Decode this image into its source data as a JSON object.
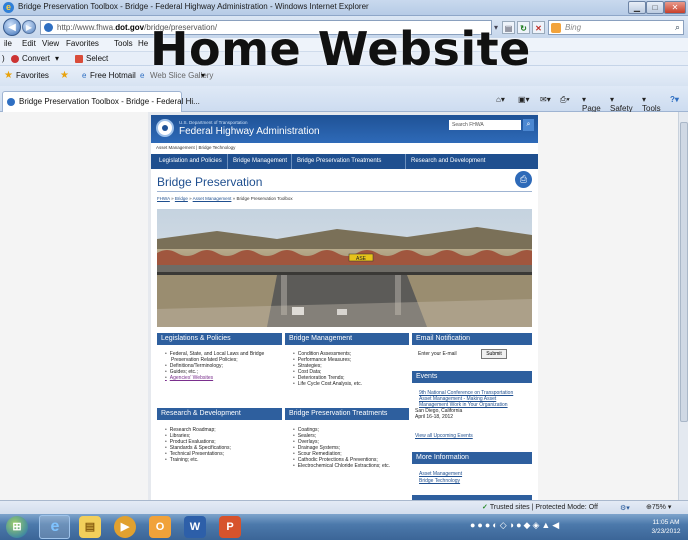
{
  "window": {
    "title": "Bridge Preservation Toolbox - Bridge - Federal Highway Administration - Windows Internet Explorer"
  },
  "address_bar": {
    "url_prefix": "http://www.fhwa.",
    "url_domain": "dot.gov",
    "url_path": "/bridge/preservation/",
    "search_placeholder": "Bing"
  },
  "menu": [
    "ile",
    "Edit",
    "View",
    "Favorites",
    "Tools",
    "He"
  ],
  "command_bar": {
    "convert_label": "Convert",
    "select_label": "Select"
  },
  "favorites_bar": {
    "favorites_label": "Favorites",
    "hotmail_label": "Free Hotmail",
    "web_slice_label": "Web Slice Gallery"
  },
  "tab": {
    "title": "Bridge Preservation Toolbox - Bridge - Federal Hi..."
  },
  "toolbar": {
    "page_label": "Page",
    "safety_label": "Safety",
    "tools_label": "Tools"
  },
  "overlay_title": "Home Website",
  "site": {
    "department": "U.S. Department of Transportation",
    "agency": "Federal Highway Administration",
    "search_placeholder": "Search FHWA",
    "utility_links": "Asset Management | Bridge Technology",
    "nav": [
      "Legislation and Policies",
      "Bridge Management",
      "Bridge Preservation Treatments",
      "Research and Development"
    ],
    "page_title": "Bridge Preservation",
    "breadcrumb": {
      "fhwa": "FHWA",
      "sep1": " » ",
      "bridge": "Bridge",
      "sep2": " » ",
      "asset": "Asset Management",
      "sep3": " » ",
      "current": "Bridge Preservation Toolbox"
    },
    "sections": {
      "legislation": {
        "title": "Legislations & Policies",
        "items": [
          "Federal, State, and Local Laws and Bridge",
          "Preservation Related Policies;",
          "Definitions/Terminology;",
          "Guides; etc.;",
          "Agencies' Websites"
        ]
      },
      "management": {
        "title": "Bridge Management",
        "items": [
          "Condition Assessments;",
          "Performance Measures;",
          "Strategies;",
          "Cost Data;",
          "Deterioration Trends;",
          "Life Cycle Cost Analysis, etc."
        ]
      },
      "research": {
        "title": "Research & Development",
        "items": [
          "Research Roadmap;",
          "Libraries;",
          "Product Evaluations;",
          "Standards & Specifications;",
          "Technical Presentations;",
          "Training; etc."
        ]
      },
      "treatments": {
        "title": "Bridge Preservation Treatments",
        "items": [
          "Coatings;",
          "Sealers;",
          "Overlays;",
          "Drainage Systems;",
          "Scour Remediation;",
          "Cathodic Protections & Preventions;",
          "Electrochemical Chloride Extractions; etc."
        ]
      },
      "email": {
        "title": "Email Notification",
        "input_placeholder": "Enter your E-mail",
        "submit": "Submit"
      },
      "events": {
        "title": "Events",
        "event_link": [
          "9th National Conference on Transportation",
          "Asset Management - Making Asset",
          "Management Work in Your Organization"
        ],
        "location": "San Diego, California",
        "dates": "April 16-18, 2012",
        "view_all": "View all Upcoming Events"
      },
      "more_info": {
        "title": "More Information",
        "links": [
          "Asset Management",
          "Bridge Technology"
        ]
      }
    },
    "sign_text": "ASE"
  },
  "status_bar": {
    "protected_mode": "Trusted sites | Protected Mode: Off",
    "zoom": "75%"
  },
  "taskbar": {
    "time": "11:05 AM",
    "date": "3/23/2012"
  }
}
